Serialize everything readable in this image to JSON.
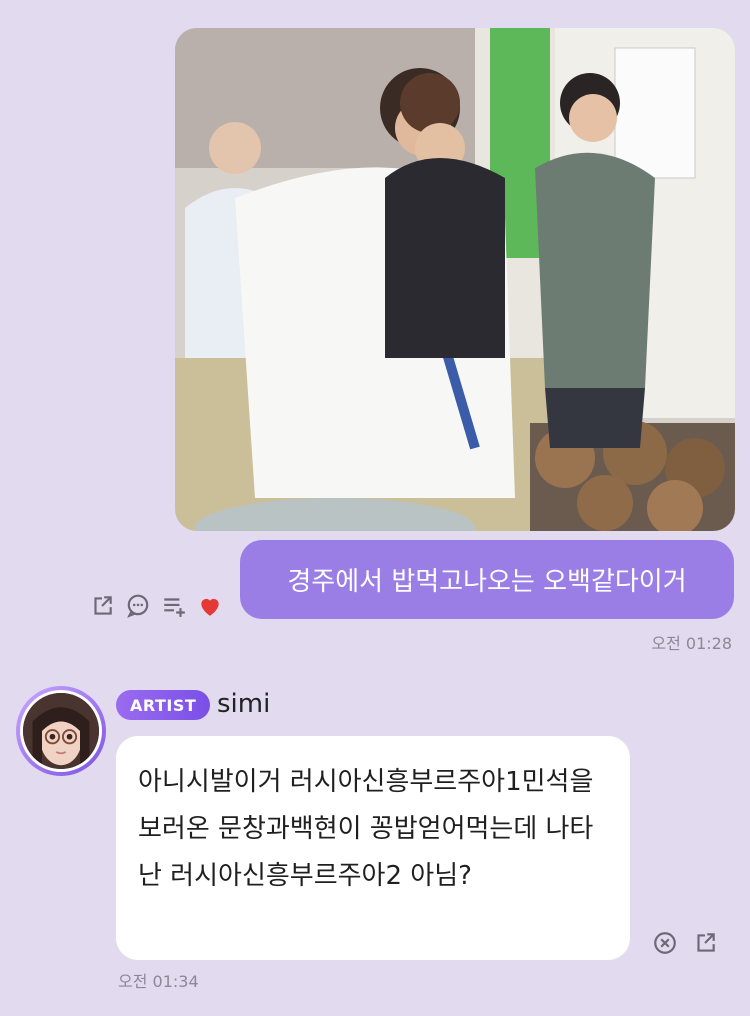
{
  "colors": {
    "background": "#e2dbef",
    "outgoing_bubble": "#9a7ee6",
    "incoming_bubble": "#ffffff",
    "artist_badge": "#8a5eec",
    "heart": "#e53935"
  },
  "shared_photo": {
    "alt_icon": "photo-image"
  },
  "outgoing_message": {
    "text": "경주에서 밥먹고나오는 오백같다이거",
    "time": "오전 01:28",
    "actions": [
      "share-icon",
      "comment-icon",
      "add-to-list-icon",
      "heart-icon"
    ]
  },
  "incoming_message": {
    "badge": "ARTIST",
    "sender": "simi",
    "text": "아니시발이거 러시아신흥부르주아1민석을 보러온 문창과백현이 꽁밥얻어먹는데 나타난 러시아신흥부르주아2 아님?",
    "time": "오전 01:34",
    "actions": [
      "close-circle-icon",
      "share-icon"
    ]
  }
}
